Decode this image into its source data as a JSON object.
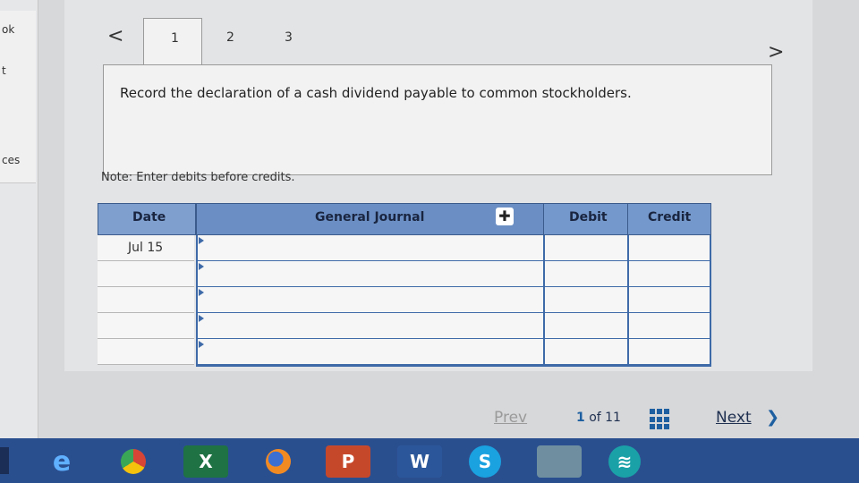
{
  "sidebar": {
    "items": [
      {
        "label": "ok"
      },
      {
        "label": "t"
      },
      {
        "label": ""
      },
      {
        "label": "ces"
      }
    ]
  },
  "tabs": {
    "prev": "<",
    "items": [
      "1",
      "2",
      "3"
    ],
    "active": "1",
    "next": ">"
  },
  "question": {
    "prompt": "Record the declaration of a cash dividend payable to common stockholders."
  },
  "note": "Note: Enter debits before credits.",
  "journal": {
    "headers": {
      "date": "Date",
      "general_journal": "General Journal",
      "debit": "Debit",
      "credit": "Credit"
    },
    "rows": [
      {
        "date": "Jul 15",
        "account": "",
        "debit": "",
        "credit": ""
      },
      {
        "date": "",
        "account": "",
        "debit": "",
        "credit": ""
      },
      {
        "date": "",
        "account": "",
        "debit": "",
        "credit": ""
      },
      {
        "date": "",
        "account": "",
        "debit": "",
        "credit": ""
      },
      {
        "date": "",
        "account": "",
        "debit": "",
        "credit": ""
      }
    ]
  },
  "pager": {
    "prev": "Prev",
    "current": "1",
    "of_text": "of 11",
    "next": "Next"
  },
  "taskbar": {
    "icons": [
      {
        "name": "edge-icon",
        "label": "e"
      },
      {
        "name": "chrome-icon",
        "label": ""
      },
      {
        "name": "excel-icon",
        "label": "X"
      },
      {
        "name": "firefox-icon",
        "label": ""
      },
      {
        "name": "powerpoint-icon",
        "label": "P"
      },
      {
        "name": "word-icon",
        "label": "W"
      },
      {
        "name": "skype-icon",
        "label": "S"
      },
      {
        "name": "apps-icon",
        "label": ""
      },
      {
        "name": "wifi-icon",
        "label": ""
      }
    ]
  },
  "colors": {
    "header": "#6b8fc4",
    "grid": "#3e6aa8",
    "taskbar": "#2a4f8f"
  }
}
